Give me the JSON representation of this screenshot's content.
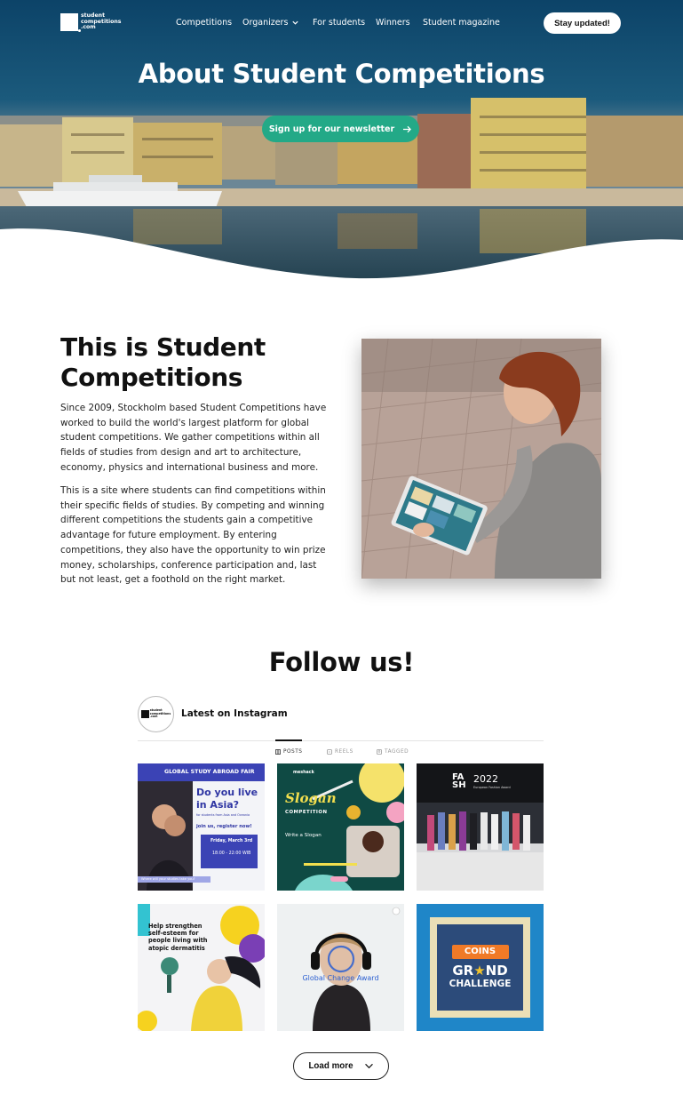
{
  "logo": {
    "line1": "student",
    "line2": "competitions",
    "line3": ".com"
  },
  "nav": {
    "items": [
      {
        "label": "Competitions"
      },
      {
        "label": "Organizers"
      },
      {
        "label": "For students"
      },
      {
        "label": "Winners"
      },
      {
        "label": "Student magazine"
      }
    ],
    "cta": "Stay updated!"
  },
  "hero": {
    "title": "About Student Competitions",
    "newsletter_button": "Sign up for our newsletter"
  },
  "about": {
    "heading": "This is Student Competitions",
    "paragraph1": "Since 2009, Stockholm based Student Competitions have worked to build the world's largest platform for global student competitions. We gather competitions within all fields of studies from design and art to architecture, economy, physics and international business and more.",
    "paragraph2": "This is a site where students can find competitions within their specific fields of studies. By competing and winning different competitions the students gain a competitive advantage for future employment. By entering competitions, they also have the opportunity to win prize money, scholarships, conference participation and, last but not least, get a foothold on the right market."
  },
  "follow": {
    "title": "Follow us!",
    "instagram_label": "Latest on Instagram",
    "avatar_text": {
      "line1": "student",
      "line2": "competitions",
      "line3": ".com"
    },
    "tabs": [
      {
        "label": "POSTS",
        "active": true
      },
      {
        "label": "REELS",
        "active": false
      },
      {
        "label": "TAGGED",
        "active": false
      }
    ],
    "posts": [
      {
        "banner": "GLOBAL STUDY ABROAD FAIR",
        "headline_line1": "Do you live",
        "headline_line2": "in Asia?",
        "sub": "for students from Asia and Oceania",
        "cta": "join us, register now!",
        "date": "Friday, March 3rd",
        "time": "18:00 - 22:00 WIB",
        "note": "Where will your studies take you?"
      },
      {
        "brand": "meshack",
        "script": "Slogan",
        "word": "COMPETITION",
        "line": "Write a Slogan"
      },
      {
        "title_a": "FA",
        "title_b": "SH",
        "year": "2022",
        "sub": "European Fashion Award"
      },
      {
        "text_line1": "Help strengthen",
        "text_line2": "self-esteem for",
        "text_line3": "people living with",
        "text_line4": "atopic dermatitis"
      },
      {
        "overlay": "Global Change Award"
      },
      {
        "badge": "COINS",
        "word1": "GR",
        "word1b": "ND",
        "word2": "CHALLENGE"
      }
    ],
    "load_more": "Load more"
  },
  "colors": {
    "hero_sky": "#0f4b6e",
    "accent_green": "#23a987",
    "text_dark": "#111111"
  }
}
